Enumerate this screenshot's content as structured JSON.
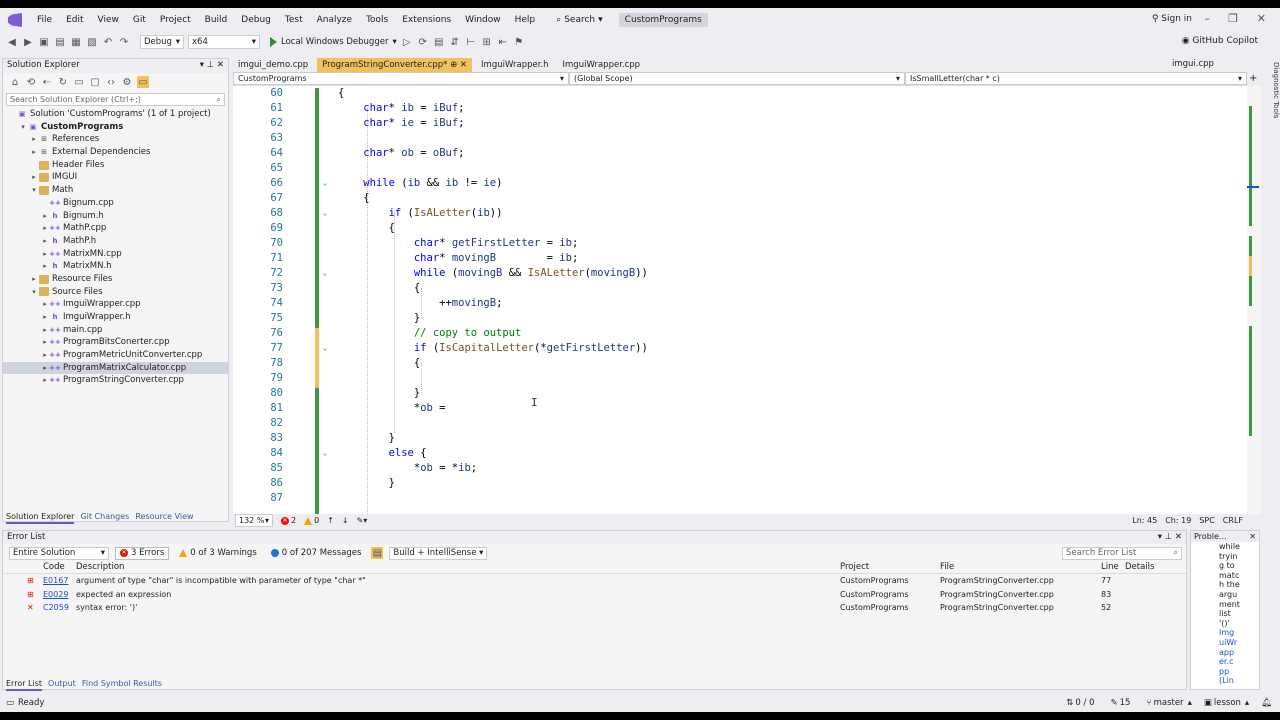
{
  "menu": [
    "File",
    "Edit",
    "View",
    "Git",
    "Project",
    "Build",
    "Debug",
    "Test",
    "Analyze",
    "Tools",
    "Extensions",
    "Window",
    "Help"
  ],
  "search_label": "Search",
  "project_title": "CustomPrograms",
  "signin": "Sign in",
  "toolbar": {
    "config": "Debug",
    "platform": "x64",
    "run_label": "Local Windows Debugger",
    "copilot": "GitHub Copilot"
  },
  "solution_explorer": {
    "title": "Solution Explorer",
    "search_placeholder": "Search Solution Explorer (Ctrl+;)",
    "items": [
      {
        "label": "Solution 'CustomPrograms' (1 of 1 project)",
        "indent": 0,
        "arrow": "",
        "icon": "solution"
      },
      {
        "label": "CustomPrograms",
        "indent": 1,
        "arrow": "▾",
        "icon": "project",
        "bold": true
      },
      {
        "label": "References",
        "indent": 2,
        "arrow": "▸",
        "icon": "ref"
      },
      {
        "label": "External Dependencies",
        "indent": 2,
        "arrow": "▸",
        "icon": "ref"
      },
      {
        "label": "Header Files",
        "indent": 2,
        "arrow": "",
        "icon": "folder"
      },
      {
        "label": "IMGUI",
        "indent": 2,
        "arrow": "▸",
        "icon": "folder"
      },
      {
        "label": "Math",
        "indent": 2,
        "arrow": "▾",
        "icon": "folder"
      },
      {
        "label": "Bignum.cpp",
        "indent": 3,
        "arrow": "",
        "icon": "cpp"
      },
      {
        "label": "Bignum.h",
        "indent": 3,
        "arrow": "▸",
        "icon": "h"
      },
      {
        "label": "MathP.cpp",
        "indent": 3,
        "arrow": "▸",
        "icon": "cpp"
      },
      {
        "label": "MathP.h",
        "indent": 3,
        "arrow": "▸",
        "icon": "h"
      },
      {
        "label": "MatrixMN.cpp",
        "indent": 3,
        "arrow": "▸",
        "icon": "cpp"
      },
      {
        "label": "MatrixMN.h",
        "indent": 3,
        "arrow": "▸",
        "icon": "h"
      },
      {
        "label": "Resource Files",
        "indent": 2,
        "arrow": "▸",
        "icon": "folder"
      },
      {
        "label": "Source Files",
        "indent": 2,
        "arrow": "▾",
        "icon": "folder"
      },
      {
        "label": "ImguiWrapper.cpp",
        "indent": 3,
        "arrow": "▸",
        "icon": "cpp"
      },
      {
        "label": "ImguiWrapper.h",
        "indent": 3,
        "arrow": "▸",
        "icon": "h"
      },
      {
        "label": "main.cpp",
        "indent": 3,
        "arrow": "▸",
        "icon": "cpp"
      },
      {
        "label": "ProgramBitsConerter.cpp",
        "indent": 3,
        "arrow": "▸",
        "icon": "cpp"
      },
      {
        "label": "ProgramMetricUnitConverter.cpp",
        "indent": 3,
        "arrow": "▸",
        "icon": "cpp"
      },
      {
        "label": "ProgramMatrixCalculator.cpp",
        "indent": 3,
        "arrow": "▸",
        "icon": "cpp",
        "selected": true
      },
      {
        "label": "ProgramStringConverter.cpp",
        "indent": 3,
        "arrow": "▸",
        "icon": "cpp"
      }
    ],
    "tabs": [
      "Solution Explorer",
      "Git Changes",
      "Resource View"
    ]
  },
  "doc_tabs": [
    {
      "label": "imgui_demo.cpp",
      "active": false
    },
    {
      "label": "ProgramStringConverter.cpp*",
      "active": true
    },
    {
      "label": "ImguiWrapper.h",
      "active": false
    },
    {
      "label": "ImguiWrapper.cpp",
      "active": false
    }
  ],
  "right_tab": "imgui.cpp",
  "navbar": {
    "project": "CustomPrograms",
    "scope": "(Global Scope)",
    "member": "IsSmallLetter(char * c)"
  },
  "code_lines": [
    {
      "n": "60",
      "html": "<span>{</span>",
      "fold": ""
    },
    {
      "n": "61",
      "html": "    <span class='kw'>char</span>* <span class='var'>ib</span> = <span class='var'>iBuf</span>;",
      "fold": ""
    },
    {
      "n": "62",
      "html": "    <span class='kw'>char</span>* <span class='var'>ie</span> = <span class='var'>iBuf</span>;",
      "fold": ""
    },
    {
      "n": "63",
      "html": "",
      "fold": ""
    },
    {
      "n": "64",
      "html": "    <span class='kw'>char</span>* <span class='var'>ob</span> = <span class='var'>oBuf</span>;",
      "fold": ""
    },
    {
      "n": "65",
      "html": "",
      "fold": ""
    },
    {
      "n": "66",
      "html": "    <span class='kw'>while</span> (<span class='var'>ib</span> &amp;&amp; <span class='var'>ib</span> != <span class='var'>ie</span>)",
      "fold": "v"
    },
    {
      "n": "67",
      "html": "    {",
      "fold": ""
    },
    {
      "n": "68",
      "html": "        <span class='kw'>if</span> (<span class='fn'>IsALetter</span>(<span class='var'>ib</span>))",
      "fold": "v"
    },
    {
      "n": "69",
      "html": "        {",
      "fold": ""
    },
    {
      "n": "70",
      "html": "            <span class='kw'>char</span>* <span class='var'>getFirstLetter</span> = <span class='var'>ib</span>;",
      "fold": ""
    },
    {
      "n": "71",
      "html": "            <span class='kw'>char</span>* <span class='var'>movingB</span>        = <span class='var'>ib</span>;",
      "fold": ""
    },
    {
      "n": "72",
      "html": "            <span class='kw'>while</span> (<span class='var'>movingB</span> &amp;&amp; <span class='fn'>IsALetter</span>(<span class='var'>movingB</span>))",
      "fold": "v"
    },
    {
      "n": "73",
      "html": "            {",
      "fold": ""
    },
    {
      "n": "74",
      "html": "                ++<span class='var'>movingB</span>;",
      "fold": ""
    },
    {
      "n": "75",
      "html": "            }",
      "fold": ""
    },
    {
      "n": "76",
      "html": "            <span class='cm'>// copy to output</span>",
      "fold": ""
    },
    {
      "n": "77",
      "html": "            <span class='kw'>if</span> (<span class='fn'>IsCapitalLetter</span>(*<span class='var'>getFirstLetter</span>))",
      "fold": "v"
    },
    {
      "n": "78",
      "html": "            {",
      "fold": ""
    },
    {
      "n": "79",
      "html": "",
      "fold": ""
    },
    {
      "n": "80",
      "html": "            }",
      "fold": ""
    },
    {
      "n": "81",
      "html": "            *<span class='var'>ob</span> =",
      "fold": ""
    },
    {
      "n": "82",
      "html": "",
      "fold": ""
    },
    {
      "n": "83",
      "html": "        }",
      "fold": ""
    },
    {
      "n": "84",
      "html": "        <span class='kw'>else</span> {",
      "fold": "v"
    },
    {
      "n": "85",
      "html": "            *<span class='var'>ob</span> = *<span class='var'>ib</span>;",
      "fold": ""
    },
    {
      "n": "86",
      "html": "        }",
      "fold": ""
    },
    {
      "n": "87",
      "html": "",
      "fold": ""
    }
  ],
  "editor_status": {
    "zoom": "132 %",
    "errors": "2",
    "warnings": "0",
    "ln": "Ln: 45",
    "ch": "Ch: 19",
    "spc": "SPC",
    "crlf": "CRLF"
  },
  "error_list": {
    "title": "Error List",
    "scope": "Entire Solution",
    "errors_btn": "3 Errors",
    "warnings_btn": "0 of 3 Warnings",
    "messages_btn": "0 of 207 Messages",
    "build_filter": "Build + IntelliSense",
    "search_placeholder": "Search Error List",
    "columns": [
      "Code",
      "Description",
      "Project",
      "File",
      "Line",
      "Details"
    ],
    "rows": [
      {
        "code": "E0167",
        "desc": "argument of type \"char\" is incompatible with parameter of type \"char *\"",
        "project": "CustomPrograms",
        "file": "ProgramStringConverter.cpp",
        "line": "77"
      },
      {
        "code": "E0029",
        "desc": "expected an expression",
        "project": "CustomPrograms",
        "file": "ProgramStringConverter.cpp",
        "line": "83"
      },
      {
        "code": "C2059",
        "desc": "syntax error: ')'",
        "project": "CustomPrograms",
        "file": "ProgramStringConverter.cpp",
        "line": "52"
      }
    ],
    "tabs": [
      "Error List",
      "Output",
      "Find Symbol Results"
    ]
  },
  "problem_panel": {
    "title": "Proble...",
    "text": [
      "while",
      "tryin",
      "g to",
      "matc",
      "h the",
      "argu",
      "ment",
      "list",
      "'()'",
      "Img",
      "uiWr",
      "app",
      "er.c",
      "pp",
      "(Lin"
    ]
  },
  "statusbar": {
    "ready": "Ready",
    "arrows": "0 / 0",
    "pencil": "15",
    "branch": "master",
    "lesson": "lesson"
  },
  "right_strip": "Diagnostic Tools",
  "colors": {
    "accent": "#6d55c6",
    "active_tab": "#f2c15d",
    "change_bar": "#3c9b3c",
    "error": "#e51400"
  }
}
